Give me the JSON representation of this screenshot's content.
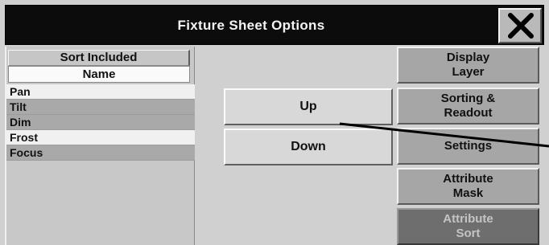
{
  "dialog": {
    "title": "Fixture Sheet Options",
    "close_icon": "close-x-icon"
  },
  "list": {
    "sort_header": "Sort Included",
    "column_header": "Name",
    "items": [
      {
        "label": "Pan",
        "style": "plain"
      },
      {
        "label": "Tilt",
        "style": "shaded"
      },
      {
        "label": "Dim",
        "style": "shaded"
      },
      {
        "label": "Frost",
        "style": "plain"
      },
      {
        "label": "Focus",
        "style": "shaded"
      }
    ]
  },
  "actions": {
    "up_label": "Up",
    "down_label": "Down"
  },
  "side_tabs": [
    {
      "label": "Display\nLayer",
      "active": false
    },
    {
      "label": "Sorting &\nReadout",
      "active": false
    },
    {
      "label": "Settings",
      "active": false
    },
    {
      "label": "Attribute\nMask",
      "active": false
    },
    {
      "label": "Attribute\nSort",
      "active": true
    }
  ],
  "colors": {
    "titlebar": "#0c0c0c",
    "panel": "#d0d0d0",
    "active_tab": "#6e6e6e"
  }
}
